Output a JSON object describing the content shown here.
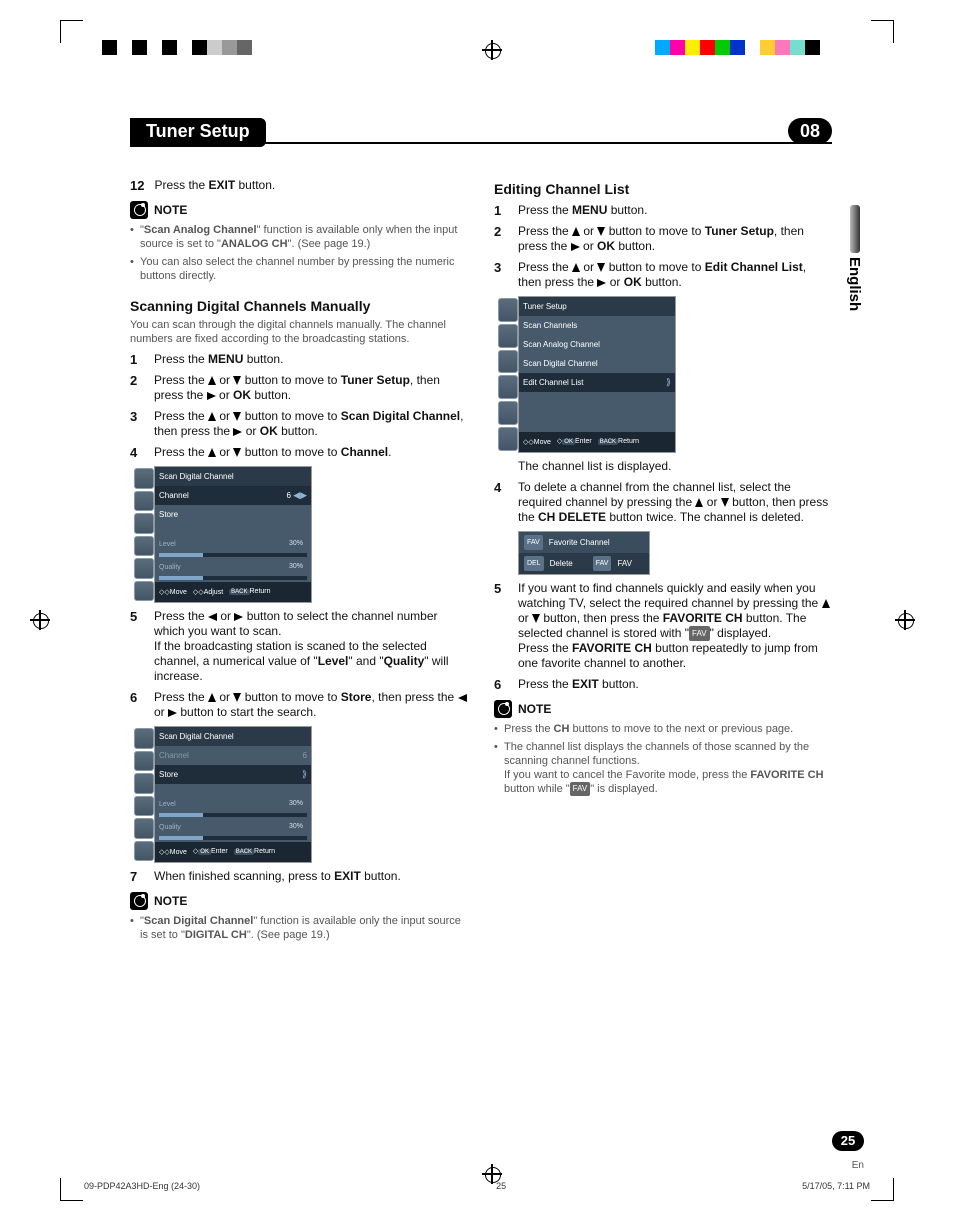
{
  "chips_left": [
    "#000000",
    "#ffffff",
    "#000000",
    "#ffffff",
    "#000000",
    "#ffffff",
    "#000000",
    "#cccccc",
    "#999999",
    "#666666"
  ],
  "chips_right": [
    "#00aaff",
    "#ff00aa",
    "#ffee00",
    "#ff0000",
    "#00cc00",
    "#0033cc",
    "#ffffff",
    "#ffcc33",
    "#ff77bb",
    "#77ddcc",
    "#000000"
  ],
  "header": {
    "title": "Tuner Setup",
    "chapter": "08"
  },
  "lang_tab": "English",
  "page_pill": "25",
  "page_en": "En",
  "footer": {
    "left": "09-PDP42A3HD-Eng (24-30)",
    "mid": "25",
    "right": "5/17/05, 7:11 PM"
  },
  "left_col": {
    "step12_num": "12",
    "step12": "Press the <b>EXIT</b> button.",
    "note_lbl": "NOTE",
    "note_items": [
      "\"<b>Scan Analog Channel</b>\" function is available only when the input source is set to \"<b>ANALOG CH</b>\". (See page 19.)",
      "You can also select the channel number by pressing the numeric buttons directly."
    ],
    "h_scan_manual": "Scanning Digital Channels Manually",
    "scan_manual_desc": "You can scan through the digital channels manually. The channel numbers are fixed according to the broadcasting stations.",
    "steps_a": [
      {
        "n": "1",
        "t": "Press the <b>MENU</b> button."
      },
      {
        "n": "2",
        "t": "Press the <span class='arrow arrow-up'></span> or <span class='arrow arrow-down'></span> button to move to <b>Tuner Setup</b>, then press the <span class='arrow arrow-right'></span> or <b>OK</b> button."
      },
      {
        "n": "3",
        "t": "Press the <span class='arrow arrow-up'></span> or <span class='arrow arrow-down'></span> button to move to <b>Scan Digital Channel</b>, then press the <span class='arrow arrow-right'></span> or <b>OK</b> button."
      },
      {
        "n": "4",
        "t": "Press the <span class='arrow arrow-up'></span> or <span class='arrow arrow-down'></span> button to move to <b>Channel</b>."
      }
    ],
    "osd1": {
      "title": "Scan Digital Channel",
      "row_channel": {
        "label": "Channel",
        "val": "6"
      },
      "row_store": "Store",
      "level": {
        "label": "Level",
        "pct": "30%"
      },
      "quality": {
        "label": "Quality",
        "pct": "30%"
      },
      "help": {
        "move": "Move",
        "adjust": "Adjust",
        "back": "BACK",
        "ret": "Return"
      }
    },
    "steps_b": [
      {
        "n": "5",
        "t": "Press the <span class='arrow arrow-left'></span> or <span class='arrow arrow-right'></span> button to select the channel number which you want to scan.<br>If the broadcasting station is scaned to the selected channel, a numerical value of \"<b>Level</b>\" and \"<b>Quality</b>\" will increase."
      },
      {
        "n": "6",
        "t": "Press the <span class='arrow arrow-up'></span> or <span class='arrow arrow-down'></span> button to move to <b>Store</b>, then press the <span class='arrow arrow-left'></span> or <span class='arrow arrow-right'></span> button to start the search."
      }
    ],
    "osd2": {
      "title": "Scan Digital Channel",
      "row_channel": {
        "label": "Channel",
        "val": "6"
      },
      "row_store": "Store",
      "level": {
        "label": "Level",
        "pct": "30%"
      },
      "quality": {
        "label": "Quality",
        "pct": "30%"
      },
      "help": {
        "move": "Move",
        "enter": "Enter",
        "back": "BACK",
        "ret": "Return"
      }
    },
    "steps_c": [
      {
        "n": "7",
        "t": "When finished scanning, press to <b>EXIT</b> button."
      }
    ],
    "note2_lbl": "NOTE",
    "note2_items": [
      "\"<b>Scan Digital Channel</b>\" function is available only the input source is set to \"<b>DIGITAL CH</b>\". (See page 19.)"
    ]
  },
  "right_col": {
    "h_edit": "Editing Channel List",
    "steps_a": [
      {
        "n": "1",
        "t": "Press the <b>MENU</b> button."
      },
      {
        "n": "2",
        "t": "Press the <span class='arrow arrow-up'></span> or <span class='arrow arrow-down'></span> button to move to <b>Tuner Setup</b>, then press the <span class='arrow arrow-right'></span> or <b>OK</b> button."
      },
      {
        "n": "3",
        "t": "Press the <span class='arrow arrow-up'></span> or <span class='arrow arrow-down'></span> button to move to <b>Edit Channel List</b>, then press the <span class='arrow arrow-right'></span> or <b>OK</b> button."
      }
    ],
    "osd_menu": {
      "title": "Tuner Setup",
      "rows": [
        "Scan Channels",
        "Scan Analog Channel",
        "Scan Digital Channel"
      ],
      "sel": "Edit Channel List",
      "help": {
        "move": "Move",
        "enter": "Enter",
        "back": "BACK",
        "ret": "Return"
      }
    },
    "caption_list": "The channel list is displayed.",
    "steps_b": [
      {
        "n": "4",
        "t": "To delete a channel from the channel list, select the required channel by pressing the <span class='arrow arrow-up'></span> or <span class='arrow arrow-down'></span> button, then press the <b>CH DELETE</b> button twice. The channel is deleted."
      }
    ],
    "favbox": {
      "row1": {
        "tag": "FAV",
        "label": "Favorite Channel"
      },
      "row2": {
        "tag1": "DEL",
        "label1": "Delete",
        "tag2": "FAV",
        "label2": "FAV"
      }
    },
    "steps_c": [
      {
        "n": "5",
        "t": "If you want to find channels quickly and easily when you watching TV, select the required channel by pressing the <span class='arrow arrow-up'></span> or <span class='arrow arrow-down'></span> button, then press the <b>FAVORITE CH</b> button. The selected channel is stored with \"<span class='favtag'>FAV</span>\" displayed.<br>Press the <b>FAVORITE CH</b> button repeatedly to jump from one favorite channel to another."
      },
      {
        "n": "6",
        "t": "Press the <b>EXIT</b> button."
      }
    ],
    "note_lbl": "NOTE",
    "note_items": [
      "Press the <b>CH</b> buttons to move to the next or previous page.",
      "The channel list displays the channels of those scanned by the scanning channel functions.<br>If you want to cancel the Favorite mode, press the <b>FAVORITE CH</b> button while \"<span class='favtag'>FAV</span>\" is displayed."
    ]
  }
}
